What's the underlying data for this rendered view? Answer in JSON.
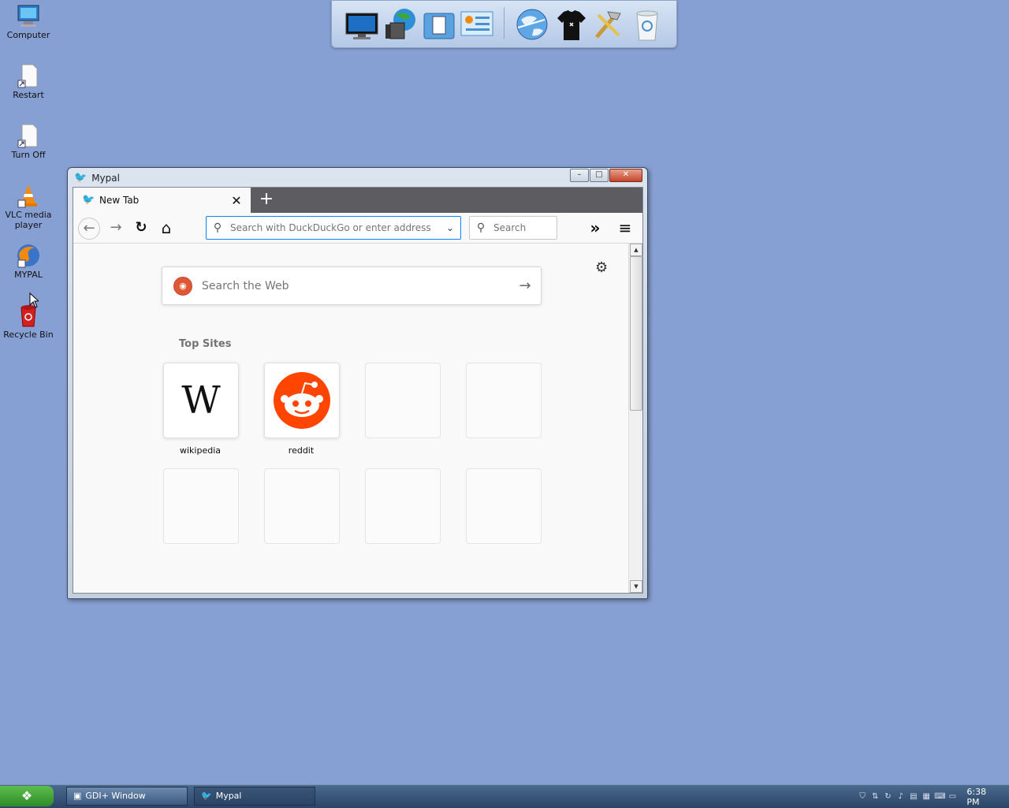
{
  "desktop": {
    "icons": [
      {
        "label": "Computer",
        "icon": "computer-icon"
      },
      {
        "label": "Restart",
        "icon": "shortcut-file-icon"
      },
      {
        "label": "Turn Off",
        "icon": "shortcut-file-icon"
      },
      {
        "label": "VLC media player",
        "icon": "vlc-cone-icon"
      },
      {
        "label": "MYPAL",
        "icon": "mypal-browser-icon"
      },
      {
        "label": "Recycle Bin",
        "icon": "recycle-bin-icon"
      }
    ]
  },
  "dock": {
    "items": [
      "monitor-icon",
      "network-globe-icon",
      "documents-folder-icon",
      "control-panel-icon",
      "internet-globe-icon",
      "tshirt-icon",
      "tools-hammer-icon",
      "trash-icon"
    ]
  },
  "window": {
    "title": "Mypal",
    "minimize": "–",
    "maximize": "□",
    "close": "✕"
  },
  "browser": {
    "tab_title": "New Tab",
    "tab_close": "✕",
    "new_tab": "+",
    "url_placeholder": "Search with DuckDuckGo or enter address",
    "search_placeholder": "Search",
    "back": "←",
    "forward": "→",
    "reload": "↻",
    "home": "⌂",
    "overflow": "»",
    "menu": "≡"
  },
  "newtab": {
    "search_placeholder": "Search the Web",
    "top_sites_title": "Top Sites",
    "sites": [
      {
        "label": "wikipedia",
        "logo": "W"
      },
      {
        "label": "reddit",
        "logo": ""
      }
    ]
  },
  "taskbar": {
    "start": "❖",
    "tasks": [
      {
        "label": "GDI+ Window"
      },
      {
        "label": "Mypal"
      }
    ],
    "clock": "6:38 PM"
  }
}
